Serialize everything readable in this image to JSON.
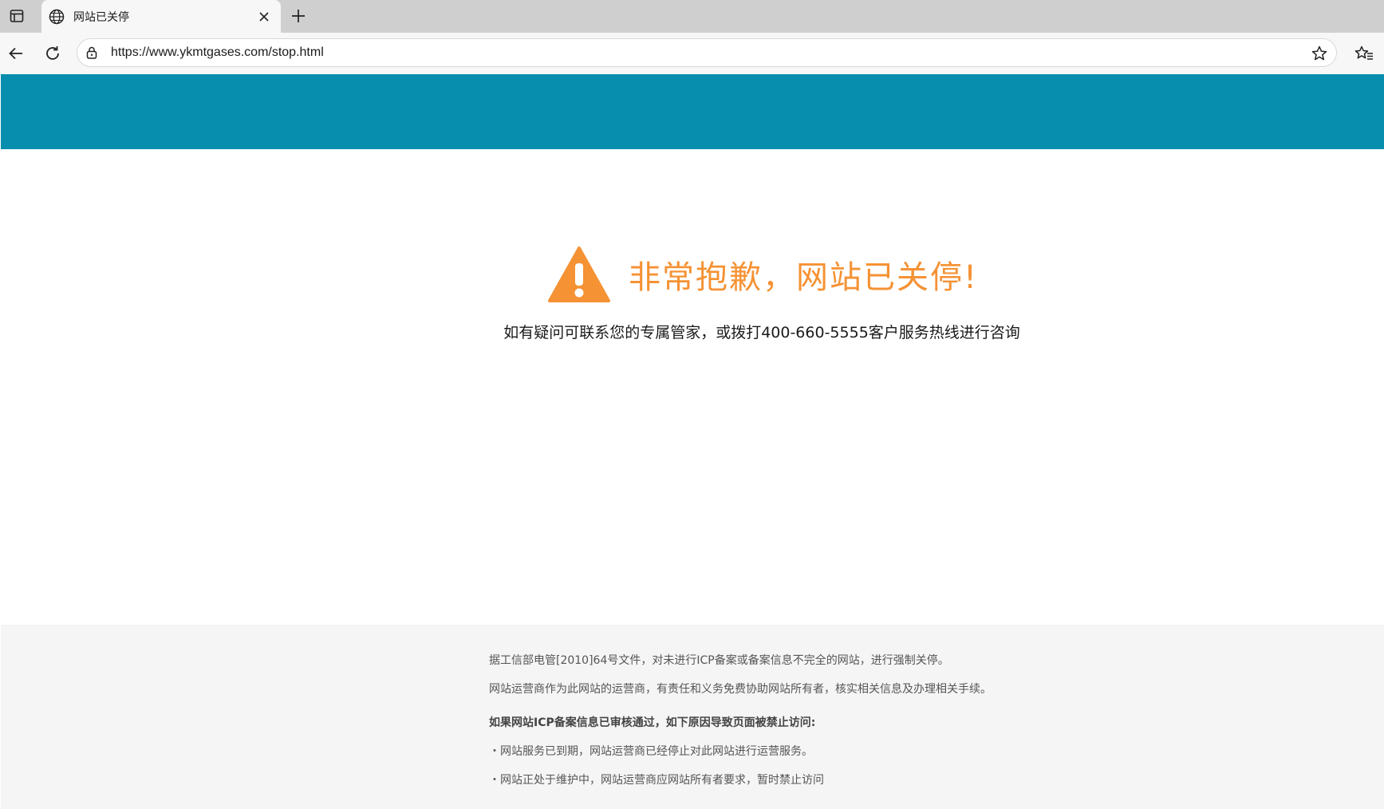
{
  "browser": {
    "tab_title": "网站已关停",
    "url": "https://www.ykmtgases.com/stop.html"
  },
  "icons": {
    "tab_actions": "tab-actions-icon",
    "tab_favicon": "globe-icon",
    "tab_close": "close-icon",
    "new_tab": "plus-icon",
    "back": "back-arrow-icon",
    "reload": "reload-icon",
    "site_info": "lock-icon",
    "favorite": "star-icon",
    "favorites": "favorites-icon",
    "notice": "warning-triangle-icon"
  },
  "colors": {
    "header_band": "#078eaf",
    "title": "#f59234",
    "footer_bg": "#f5f5f5"
  },
  "notice": {
    "title": "非常抱歉，网站已关停!",
    "subtitle": "如有疑问可联系您的专属管家，或拨打400-660-5555客户服务热线进行咨询"
  },
  "footer": {
    "line1": "据工信部电管[2010]64号文件，对未进行ICP备案或备案信息不完全的网站，进行强制关停。",
    "line2": "网站运营商作为此网站的运营商，有责任和义务免费协助网站所有者，核实相关信息及办理相关手续。",
    "reasons_heading": "如果网站ICP备案信息已审核通过，如下原因导致页面被禁止访问:",
    "reason1": "・网站服务已到期，网站运营商已经停止对此网站进行运营服务。",
    "reason2": "・网站正处于维护中，网站运营商应网站所有者要求，暂时禁止访问"
  }
}
